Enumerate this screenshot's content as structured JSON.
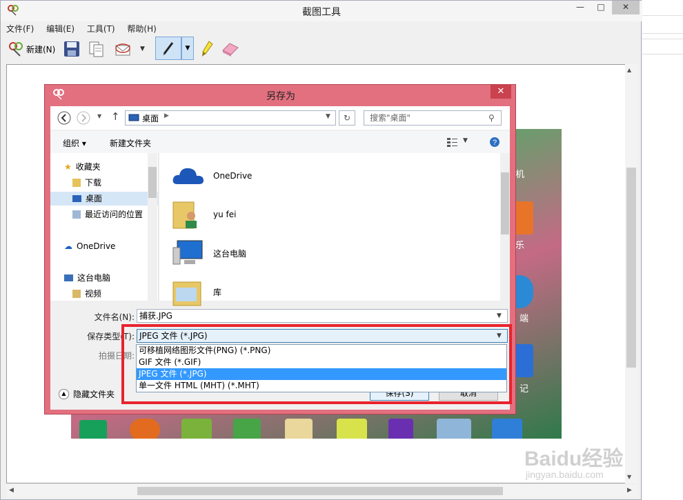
{
  "app": {
    "title": "截图工具"
  },
  "window_buttons": {
    "minimize": "—",
    "maximize": "□",
    "close": "✕"
  },
  "menu": [
    "文件(F)",
    "编辑(E)",
    "工具(T)",
    "帮助(H)"
  ],
  "toolbar": {
    "new_label": "新建(N)"
  },
  "dialog": {
    "title": "另存为",
    "close": "✕",
    "address": "桌面",
    "search_placeholder": "搜索\"桌面\"",
    "organize": "组织 ▾",
    "new_folder": "新建文件夹",
    "nav_items": [
      "收藏夹",
      "下载",
      "桌面",
      "最近访问的位置",
      "OneDrive",
      "这台电脑",
      "视频"
    ],
    "files": [
      "OneDrive",
      "yu fei",
      "这台电脑",
      "库"
    ],
    "filename_label": "文件名(N):",
    "filename_value": "捕获.JPG",
    "filetype_label": "保存类型(T):",
    "filetype_value": "JPEG 文件 (*.JPG)",
    "date_label": "拍摄日期:",
    "hide_folders": "隐藏文件夹",
    "save_button": "保存(S)",
    "cancel_button": "取消",
    "type_options": [
      "可移植网络图形文件(PNG) (*.PNG)",
      "GIF 文件 (*.GIF)",
      "JPEG 文件 (*.JPG)",
      "单一文件 HTML (MHT) (*.MHT)"
    ],
    "selected_option_index": 2
  },
  "background_labels": [
    "机",
    "乐",
    "端",
    "记"
  ],
  "watermark": {
    "brand": "Baidu经验",
    "url": "jingyan.baidu.com"
  },
  "colors": {
    "dialog_frame": "#e2707f",
    "highlight_box": "#e8232d",
    "selection": "#3399ff"
  }
}
